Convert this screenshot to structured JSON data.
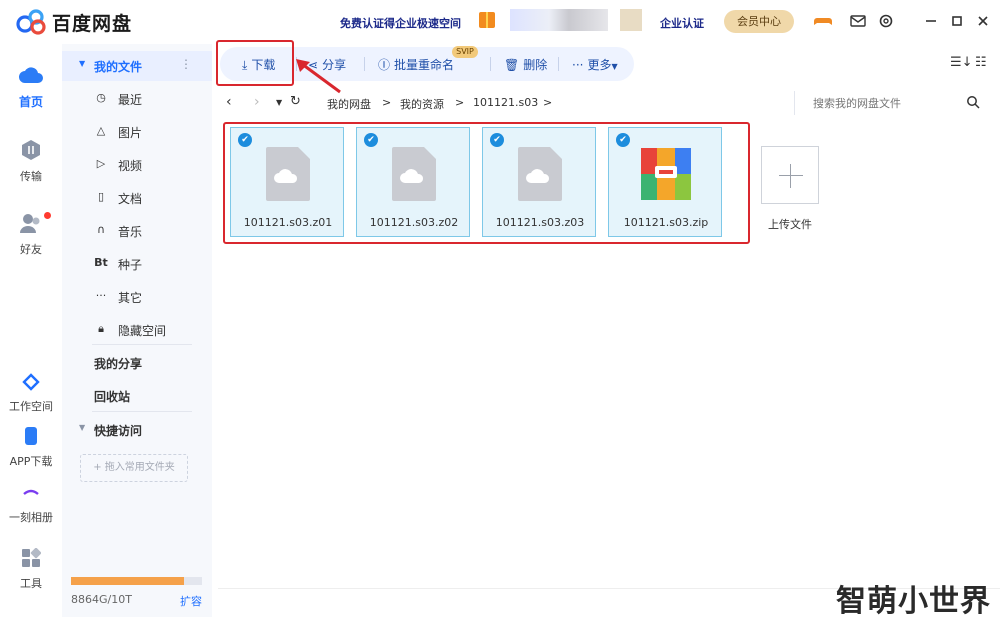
{
  "app": {
    "title": "百度网盘",
    "promo_text": "免费认证得企业极速空间",
    "enterprise_label": "企业认证",
    "vip_button": "会员中心"
  },
  "leftnav": {
    "items": [
      {
        "label": "首页",
        "icon": "cloud-icon"
      },
      {
        "label": "传输",
        "icon": "transfer-icon"
      },
      {
        "label": "好友",
        "icon": "friends-icon"
      },
      {
        "label": "工作空间",
        "icon": "workspace-icon"
      },
      {
        "label": "APP下载",
        "icon": "phone-icon"
      },
      {
        "label": "一刻相册",
        "icon": "album-icon"
      },
      {
        "label": "工具",
        "icon": "tools-icon"
      }
    ]
  },
  "sidebar": {
    "my_files": "我的文件",
    "items": [
      {
        "label": "最近",
        "icon": "clock-icon"
      },
      {
        "label": "图片",
        "icon": "image-icon"
      },
      {
        "label": "视频",
        "icon": "play-icon"
      },
      {
        "label": "文档",
        "icon": "document-icon"
      },
      {
        "label": "音乐",
        "icon": "headphones-icon"
      },
      {
        "label": "种子",
        "icon": "torrent-icon"
      },
      {
        "label": "其它",
        "icon": "more-icon"
      },
      {
        "label": "隐藏空间",
        "icon": "lock-icon"
      }
    ],
    "my_share": "我的分享",
    "recycle": "回收站",
    "quick_access": "快捷访问",
    "drop_hint": "+ 拖入常用文件夹",
    "quota_text": "8864G/10T",
    "quota_fraction": 0.8656,
    "expand": "扩容"
  },
  "toolbar": {
    "download": "下载",
    "share": "分享",
    "rename": "批量重命名",
    "svip": "SVIP",
    "delete": "删除",
    "more": "更多"
  },
  "breadcrumb": [
    "我的网盘",
    "我的资源",
    "101121.s03"
  ],
  "search": {
    "placeholder": "搜索我的网盘文件"
  },
  "files": [
    {
      "name": "101121.s03.z01",
      "type": "cloud",
      "selected": true
    },
    {
      "name": "101121.s03.z02",
      "type": "cloud",
      "selected": true
    },
    {
      "name": "101121.s03.z03",
      "type": "cloud",
      "selected": true
    },
    {
      "name": "101121.s03.zip",
      "type": "zip",
      "selected": true
    }
  ],
  "upload_label": "上传文件",
  "watermark": "智萌小世界",
  "colors": {
    "accent": "#1f6fff",
    "highlight": "#d9272e",
    "selected_bg": "#e5f4fb"
  }
}
